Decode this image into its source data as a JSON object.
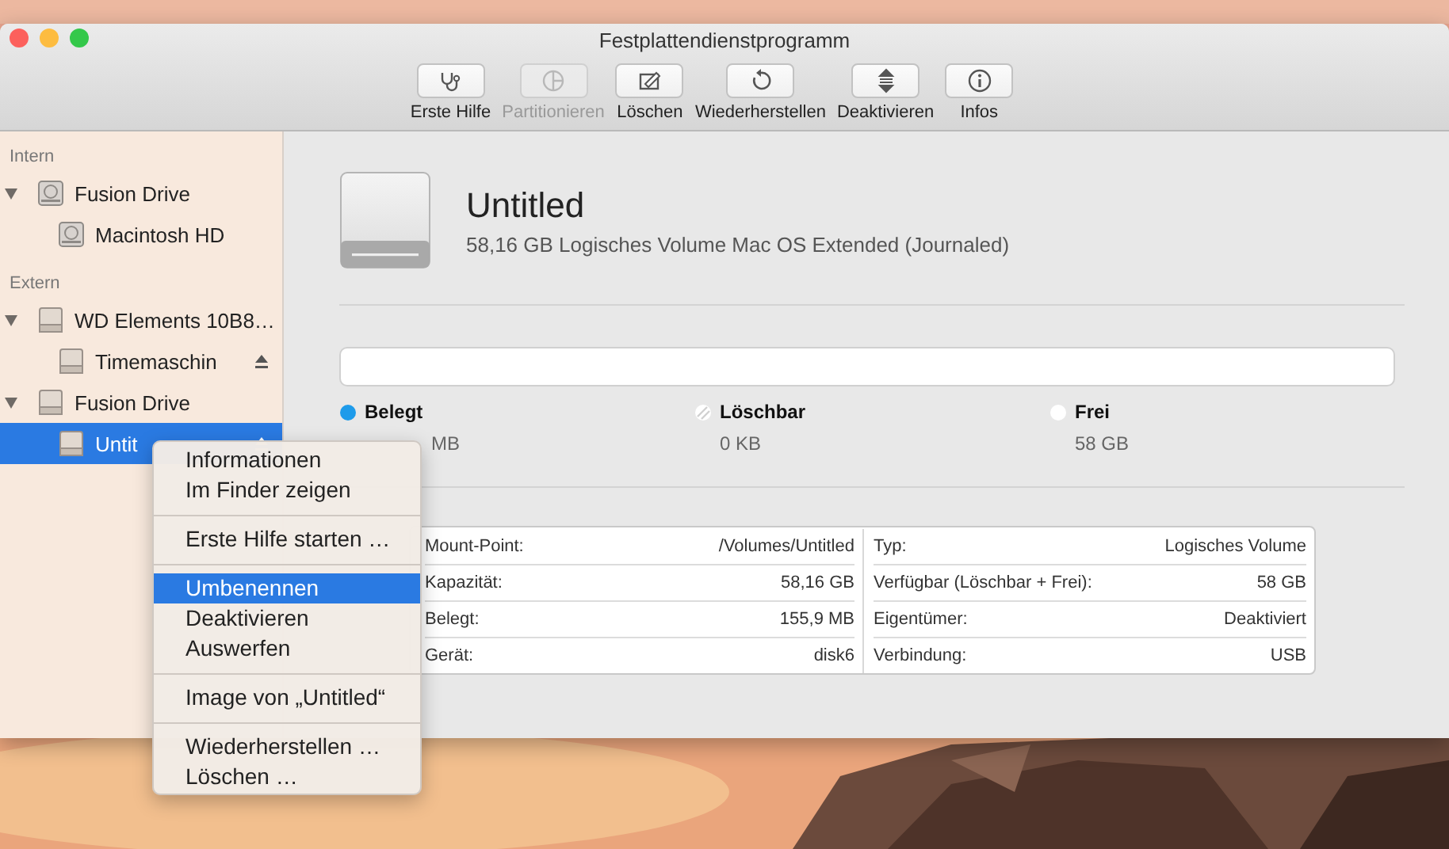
{
  "window": {
    "title": "Festplattendienstprogramm"
  },
  "toolbar": [
    {
      "label": "Erste Hilfe",
      "kind": "firstaid",
      "disabled": false
    },
    {
      "label": "Partitionieren",
      "kind": "partition",
      "disabled": true
    },
    {
      "label": "Löschen",
      "kind": "erase",
      "disabled": false
    },
    {
      "label": "Wiederherstellen",
      "kind": "restore",
      "disabled": false
    },
    {
      "label": "Deaktivieren",
      "kind": "unmount",
      "disabled": false
    },
    {
      "label": "Infos",
      "kind": "info",
      "disabled": false
    }
  ],
  "sidebar": [
    {
      "header": "Intern",
      "items": [
        {
          "name": "Fusion Drive",
          "kind": "internal",
          "expanded": true,
          "selected": false,
          "ejectable": false,
          "children": [
            {
              "name": "Macintosh HD",
              "kind": "internal",
              "selected": false,
              "ejectable": false
            }
          ]
        }
      ]
    },
    {
      "header": "Extern",
      "items": [
        {
          "name": "WD Elements 10B8…",
          "kind": "external",
          "expanded": true,
          "selected": false,
          "ejectable": false,
          "children": [
            {
              "name": "Timemaschin",
              "kind": "external",
              "selected": false,
              "ejectable": true
            }
          ]
        },
        {
          "name": "Fusion Drive",
          "kind": "external",
          "expanded": true,
          "selected": false,
          "ejectable": false,
          "children": [
            {
              "name": "Untit",
              "kind": "external",
              "selected": true,
              "ejectable": true
            }
          ]
        }
      ]
    }
  ],
  "volume": {
    "name": "Untitled",
    "description": "58,16 GB Logisches Volume Mac OS Extended (Journaled)"
  },
  "usage": {
    "legend": [
      {
        "label": "Belegt",
        "value": "MB",
        "kind": "used",
        "color": "#1e9bea"
      },
      {
        "label": "Löschbar",
        "value": "0 KB",
        "kind": "purgeable",
        "color": "#ffffff"
      },
      {
        "label": "Frei",
        "value": "58 GB",
        "kind": "free",
        "color": "#ffffff"
      }
    ]
  },
  "info": {
    "left": [
      {
        "label": "Mount-Point:",
        "value": "/Volumes/Untitled"
      },
      {
        "label": "Kapazität:",
        "value": "58,16 GB"
      },
      {
        "label": "Belegt:",
        "value": "155,9 MB"
      },
      {
        "label": "Gerät:",
        "value": "disk6"
      }
    ],
    "right": [
      {
        "label": "Typ:",
        "value": "Logisches Volume"
      },
      {
        "label": "Verfügbar (Löschbar + Frei):",
        "value": "58 GB"
      },
      {
        "label": "Eigentümer:",
        "value": "Deaktiviert"
      },
      {
        "label": "Verbindung:",
        "value": "USB"
      }
    ]
  },
  "context_menu": [
    [
      {
        "label": "Informationen",
        "selected": false
      },
      {
        "label": "Im Finder zeigen",
        "selected": false
      }
    ],
    [
      {
        "label": "Erste Hilfe starten …",
        "selected": false
      }
    ],
    [
      {
        "label": "Umbenennen",
        "selected": true
      },
      {
        "label": "Deaktivieren",
        "selected": false
      },
      {
        "label": "Auswerfen",
        "selected": false
      }
    ],
    [
      {
        "label": "Image von „Untitled“",
        "selected": false
      }
    ],
    [
      {
        "label": "Wiederherstellen …",
        "selected": false
      },
      {
        "label": "Löschen …",
        "selected": false
      }
    ]
  ]
}
